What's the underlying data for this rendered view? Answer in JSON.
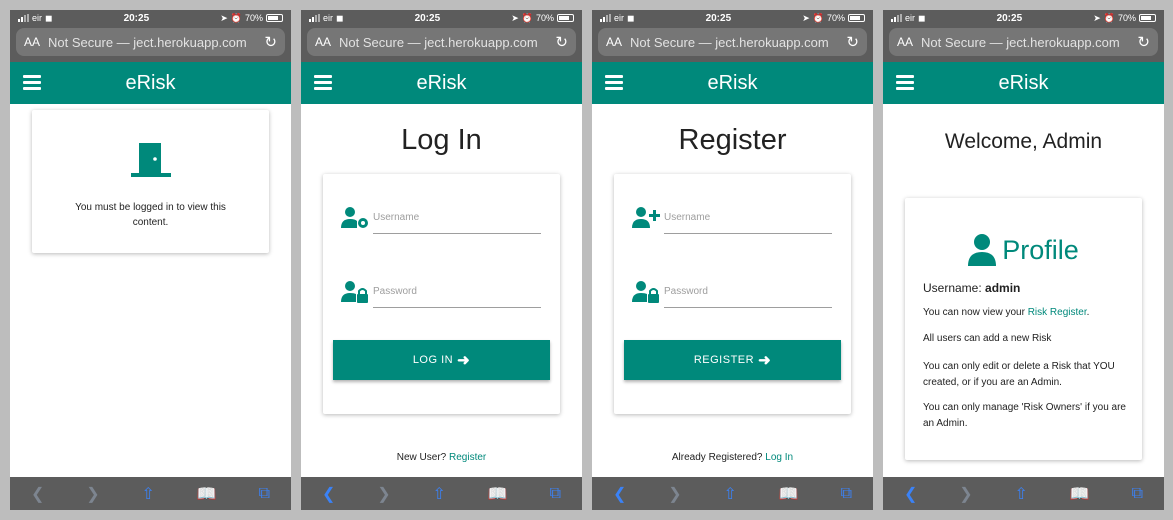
{
  "status": {
    "carrier": "eir",
    "time": "20:25",
    "battery": "70%"
  },
  "browser": {
    "aa_label": "AA",
    "url": "Not Secure — ject.herokuapp.com"
  },
  "app": {
    "title": "eRisk",
    "accent_color": "#00897b"
  },
  "screens": {
    "guard": {
      "message": "You must be logged in to view this content."
    },
    "login": {
      "heading": "Log In",
      "username_placeholder": "Username",
      "password_placeholder": "Password",
      "button_label": "LOG IN",
      "footer_text": "New User?",
      "footer_link": "Register"
    },
    "register": {
      "heading": "Register",
      "username_placeholder": "Username",
      "password_placeholder": "Password",
      "button_label": "REGISTER",
      "footer_text": "Already Registered?",
      "footer_link": "Log In"
    },
    "profile": {
      "welcome": "Welcome, Admin",
      "title": "Profile",
      "username_label": "Username:",
      "username_value": "admin",
      "line1_prefix": "You can now view your",
      "line1_link": "Risk Register",
      "line1_suffix": ".",
      "line2": "All users can add a new Risk",
      "line3": "You can only edit or delete a Risk that YOU created, or if you are an Admin.",
      "line4": "You can only manage 'Risk Owners' if you are an Admin."
    }
  },
  "toolbar_icons": [
    "back-icon",
    "forward-icon",
    "share-icon",
    "bookmarks-icon",
    "tabs-icon"
  ]
}
